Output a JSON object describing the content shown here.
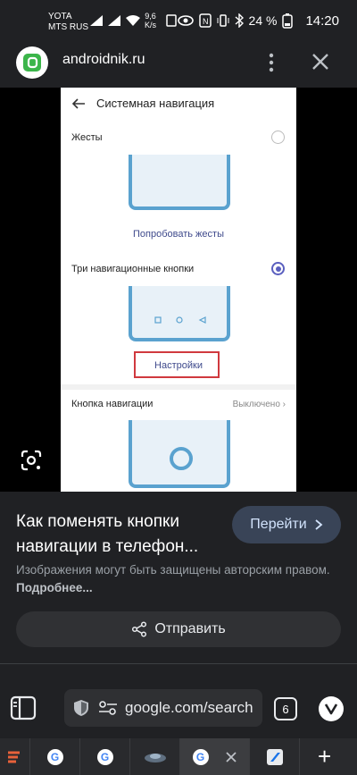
{
  "status_bar": {
    "carrier_line1": "YOTA",
    "carrier_line2": "MTS RUS",
    "speed_value": "9,6",
    "speed_unit": "K/s",
    "battery": "24 %",
    "time": "14:20"
  },
  "header": {
    "site_name": "androidnik.ru"
  },
  "screenshot": {
    "title": "Системная навигация",
    "gestures_label": "Жесты",
    "try_gestures_link": "Попробовать жесты",
    "three_buttons_label": "Три навигационные кнопки",
    "settings_link": "Настройки",
    "nav_button_label": "Кнопка навигации",
    "nav_button_value": "Выключено"
  },
  "info": {
    "title": "Как поменять кнопки навигации в телефон...",
    "go_button": "Перейти",
    "note": "Изображения могут быть защищены авторским правом.",
    "more_link": "Подробнее...",
    "share_button": "Отправить"
  },
  "toolbar": {
    "url": "google.com/search",
    "tab_count": "6"
  },
  "tabstrip": {
    "google_fav": "G"
  },
  "colors": {
    "background": "#202124",
    "accent_button": "#394457",
    "highlight_box": "#d0393e",
    "phone_outline": "#5aa2cf"
  }
}
